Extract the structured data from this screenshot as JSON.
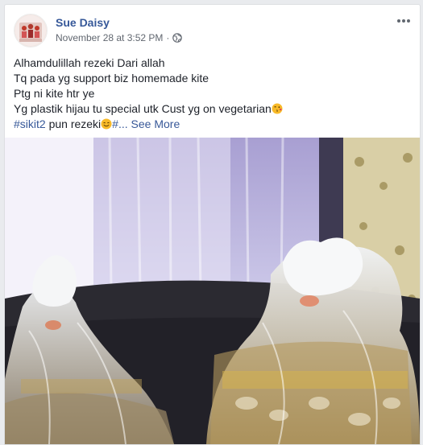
{
  "post": {
    "author": "Sue Daisy",
    "timestamp": "November 28 at 3:52 PM",
    "separator": "·",
    "privacy_icon": "globe-icon",
    "menu_icon": "more-horizontal-icon",
    "lines": {
      "l1": "Alhamdulillah rezeki Dari allah",
      "l2": "Tq pada yg support biz homemade kite",
      "l3": "Ptg ni kite htr ye",
      "l4": "Yg plastik hijau tu special utk Cust yg on vegetarian",
      "l5_hashtag": "#sikit2",
      "l5_text": " pun rezeki",
      "l5_hash2": "#...",
      "see_more": "See More"
    },
    "emojis": {
      "kiss": "face-blowing-kiss-emoji",
      "smile": "smiling-face-emoji"
    },
    "photo_subject": "post-photo"
  },
  "colors": {
    "link": "#365899",
    "text": "#1d2129",
    "meta": "#616770",
    "background": "#e9ebee",
    "card": "#ffffff"
  }
}
